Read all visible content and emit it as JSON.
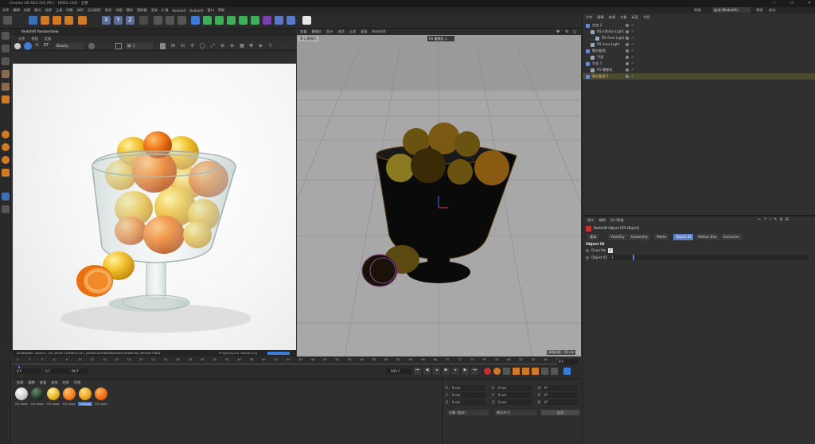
{
  "window": {
    "title": "Cinema 4D R23.110 (RC) - [0001.c4d] - 主要",
    "min": "—",
    "max": "☐",
    "close": "✕"
  },
  "menubar": {
    "items": [
      "文件",
      "编辑",
      "创建",
      "模式",
      "选择",
      "工具",
      "网格",
      "体积",
      "运动图形",
      "角色",
      "动画",
      "模拟",
      "跟踪器",
      "渲染",
      "扩展",
      "Redshift",
      "Redshift",
      "窗口",
      "帮助"
    ],
    "layout_label": "界面:",
    "layout_value": "启动 (Redshift)",
    "extra": [
      "界面",
      "启动"
    ]
  },
  "renderview": {
    "title": "Redshift RenderView",
    "menu": [
      "文件",
      "视图",
      "定制"
    ],
    "preset": "Beauty",
    "frame_label": "帧: 1",
    "status_text": "ShadeNode sphere_std_RSVertexMaterial_kd4b9ca4f584b6ea9456f4fe8ef0a_B5f40175824",
    "progress_label": "Progressive Rendering",
    "progress_pct": 100
  },
  "viewport": {
    "menu": [
      "查看",
      "摄像机",
      "显示",
      "选项",
      "过滤",
      "面板",
      "Redshift"
    ],
    "camera_label": "默认摄像机",
    "camera_field": "RS 摄像机 1",
    "grid_label": "网格间距 : 50 cm"
  },
  "timeline": {
    "ticks": [
      "0",
      "2",
      "4",
      "6",
      "8",
      "10",
      "12",
      "14",
      "16",
      "18",
      "20",
      "22",
      "24",
      "26",
      "28",
      "30",
      "32",
      "34",
      "36",
      "38",
      "40",
      "42",
      "44",
      "46",
      "48",
      "50",
      "52",
      "54",
      "56",
      "58",
      "60",
      "62",
      "64",
      "66",
      "68",
      "70",
      "72",
      "74",
      "76",
      "78",
      "80",
      "82",
      "84",
      "86",
      "88",
      "90"
    ],
    "start": "0 F",
    "current": "0 F",
    "end": "90 F",
    "field_right": "0 F",
    "frame_display": "945 F"
  },
  "materials": {
    "menu": [
      "创建",
      "编辑",
      "查看",
      "选择",
      "材质",
      "纹理"
    ],
    "items": [
      {
        "label": "RS Mate"
      },
      {
        "label": "RS Mate"
      },
      {
        "label": "RS Mate"
      },
      {
        "label": "RS Mate"
      },
      {
        "label": "Orange"
      },
      {
        "label": "RS Mate"
      }
    ]
  },
  "coords": {
    "rows": [
      [
        "X",
        "0 cm",
        "X",
        "0 cm",
        "H",
        "0°"
      ],
      [
        "Y",
        "0 cm",
        "Y",
        "0 cm",
        "P",
        "0°"
      ],
      [
        "Z",
        "0 cm",
        "Z",
        "0 cm",
        "B",
        "0°"
      ]
    ],
    "mode": "对象 (相对)",
    "size_mode": "绝对尺寸",
    "apply": "应用"
  },
  "objects": {
    "menu": [
      "文件",
      "编辑",
      "查看",
      "对象",
      "标签",
      "书签"
    ],
    "rows": [
      {
        "name": "空白 2",
        "indent": 0,
        "color": "#c8c8c8"
      },
      {
        "name": "RS Infinite Light",
        "indent": 1,
        "color": "#c8c8c8"
      },
      {
        "name": "RS Area Light 1",
        "indent": 2,
        "color": "#c8c8c8"
      },
      {
        "name": "RS Area Light",
        "indent": 1,
        "color": "#c8c8c8"
      },
      {
        "name": "细分曲面",
        "indent": 0,
        "color": "#c8c8c8"
      },
      {
        "name": "平面",
        "indent": 1,
        "color": "#c8c8c8"
      },
      {
        "name": "空白 1",
        "indent": 0,
        "color": "#c8c8c8"
      },
      {
        "name": "RS 摄像机",
        "indent": 1,
        "color": "#c8c8c8"
      },
      {
        "name": "细分曲面.1",
        "indent": 0,
        "color": "#f0c060"
      }
    ]
  },
  "attributes": {
    "menu": [
      "模式",
      "编辑",
      "用户数据"
    ],
    "title": "Redshift Object [RS Object]",
    "tabs": [
      "基本",
      "Visibility",
      "Geometry",
      "Matte",
      "Object ID",
      "Motion Blur",
      "Exclusion"
    ],
    "active_tab": "Object ID",
    "section": "Object ID",
    "override_label": "Override",
    "override_checked": true,
    "objid_label": "Object ID",
    "objid_value": "1"
  },
  "colors": {
    "accent": "#3d7bd6",
    "bg": "#333333",
    "panel": "#303030",
    "selected_row": "#5a5a3a"
  }
}
